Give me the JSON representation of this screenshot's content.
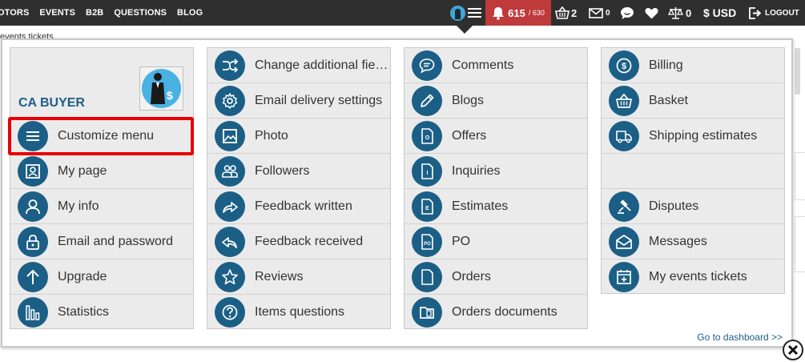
{
  "nav": {
    "links": [
      "OTORS",
      "EVENTS",
      "B2B",
      "QUESTIONS",
      "BLOG"
    ]
  },
  "toolbar": {
    "notifications_count": "615",
    "notifications_total": "/ 630",
    "basket_count": "2",
    "messages_count": "0",
    "compare_count": "0",
    "currency": "$ USD",
    "logout_label": "LOGOUT"
  },
  "page": {
    "breadcrumb": "events tickets"
  },
  "menu": {
    "profile_name": "CA BUYER",
    "columns": [
      {
        "items": [
          {
            "label": "Customize menu",
            "icon": "menu-icon"
          },
          {
            "label": "My page",
            "icon": "portrait-icon"
          },
          {
            "label": "My info",
            "icon": "user-icon"
          },
          {
            "label": "Email and password",
            "icon": "lock-icon"
          },
          {
            "label": "Upgrade",
            "icon": "arrow-up-icon"
          },
          {
            "label": "Statistics",
            "icon": "statistics-icon"
          }
        ]
      },
      {
        "items": [
          {
            "label": "Change additional fie…",
            "icon": "shuffle-icon"
          },
          {
            "label": "Email delivery settings",
            "icon": "gear-icon"
          },
          {
            "label": "Photo",
            "icon": "image-icon"
          },
          {
            "label": "Followers",
            "icon": "followers-icon"
          },
          {
            "label": "Feedback written",
            "icon": "share-icon"
          },
          {
            "label": "Feedback received",
            "icon": "reply-icon"
          },
          {
            "label": "Reviews",
            "icon": "star-icon"
          },
          {
            "label": "Items questions",
            "icon": "question-icon"
          }
        ]
      },
      {
        "items": [
          {
            "label": "Comments",
            "icon": "comment-icon"
          },
          {
            "label": "Blogs",
            "icon": "pencil-icon"
          },
          {
            "label": "Offers",
            "icon": "document-o-icon"
          },
          {
            "label": "Inquiries",
            "icon": "document-i-icon"
          },
          {
            "label": "Estimates",
            "icon": "document-e-icon"
          },
          {
            "label": "PO",
            "icon": "document-po-icon"
          },
          {
            "label": "Orders",
            "icon": "document-icon"
          },
          {
            "label": "Orders documents",
            "icon": "folder-icon"
          }
        ]
      },
      {
        "items": [
          {
            "label": "Billing",
            "icon": "dollar-icon"
          },
          {
            "label": "Basket",
            "icon": "basket-icon"
          },
          {
            "label": "Shipping estimates",
            "icon": "truck-icon"
          },
          {
            "label": "",
            "icon": ""
          },
          {
            "label": "Disputes",
            "icon": "gavel-icon"
          },
          {
            "label": "Messages",
            "icon": "envelope-icon"
          },
          {
            "label": "My events tickets",
            "icon": "calendar-plus-icon"
          }
        ]
      }
    ],
    "dashboard_link": "Go to dashboard >>"
  },
  "colors": {
    "accent": "#1c5f86",
    "topbar": "#2f2f2f",
    "notification": "#bf3b3b",
    "highlight": "#e80000",
    "item_bg": "#ebebeb"
  }
}
